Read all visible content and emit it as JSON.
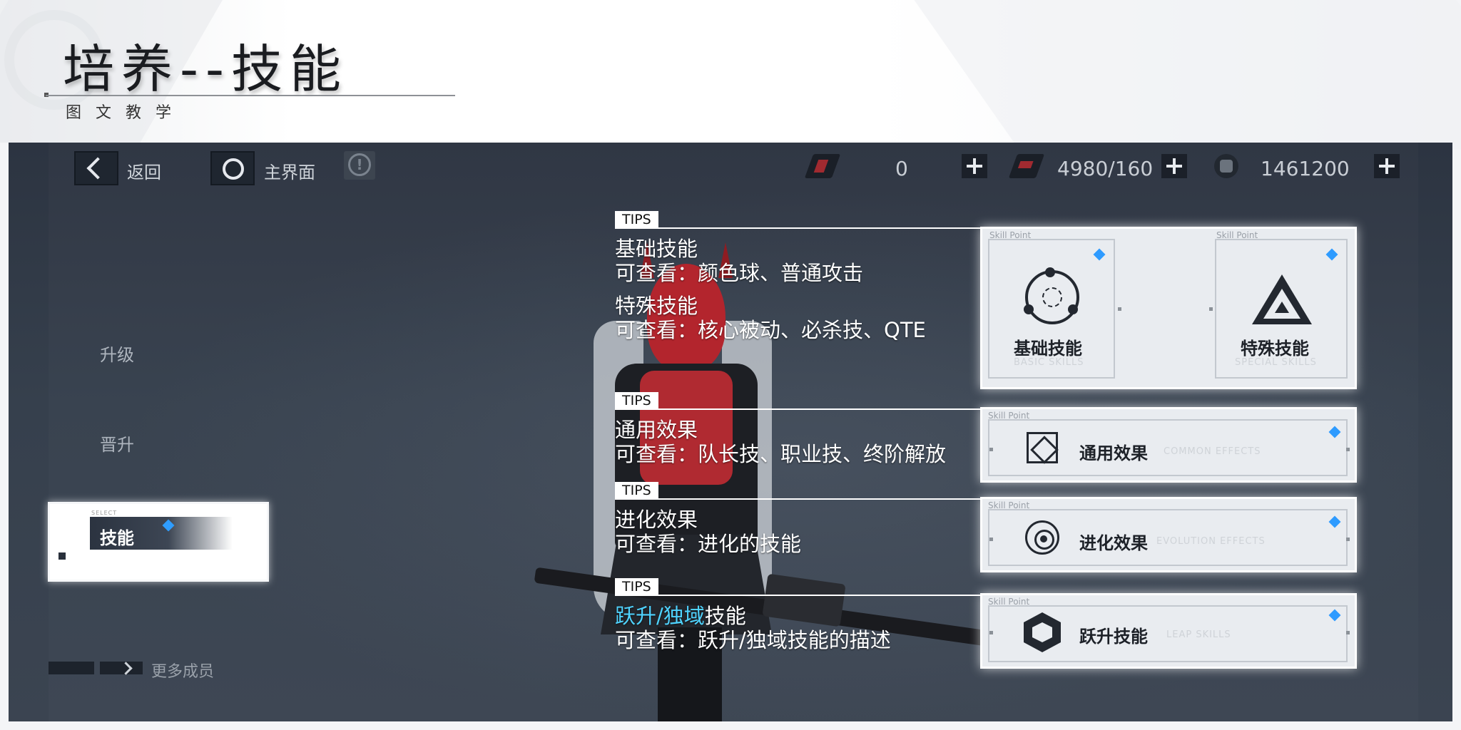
{
  "slide": {
    "title": "培养--技能",
    "subtitle": "图文教学"
  },
  "topbar": {
    "back_label": "返回",
    "home_label": "主界面",
    "resources": [
      {
        "value": "0"
      },
      {
        "value": "4980/160"
      },
      {
        "value": "1461200"
      }
    ]
  },
  "menu": {
    "items": [
      "升级",
      "晋升"
    ],
    "selected": {
      "select_tag": "SELECT",
      "label": "技能"
    },
    "more_members": "更多成员"
  },
  "tips": {
    "badge": "TIPS",
    "group1": {
      "line1": "基础技能",
      "line2": "可查看：颜色球、普通攻击",
      "line3": "特殊技能",
      "line4": "可查看：核心被动、必杀技、QTE"
    },
    "group2": {
      "line1": "通用效果",
      "line2": "可查看：队长技、职业技、终阶解放"
    },
    "group3": {
      "line1": "进化效果",
      "line2": "可查看：进化的技能"
    },
    "group4": {
      "line1_hl": "跃升/独域",
      "line1_rest": "技能",
      "line2": "可查看：跃升/独域技能的描述"
    }
  },
  "cards": {
    "skill_point": "Skill Point",
    "basic": {
      "name": "基础技能",
      "en": "BASIC SKILLS"
    },
    "special": {
      "name": "特殊技能",
      "en": "SPECIAL SKILLS"
    },
    "common": {
      "name": "通用效果",
      "en": "COMMON EFFECTS"
    },
    "evolution": {
      "name": "进化效果",
      "en": "EVOLUTION EFFECTS"
    },
    "leap": {
      "name": "跃升技能",
      "en": "LEAP SKILLS"
    }
  },
  "colors": {
    "accent": "#2e9bff",
    "highlight": "#4fd3ff"
  }
}
